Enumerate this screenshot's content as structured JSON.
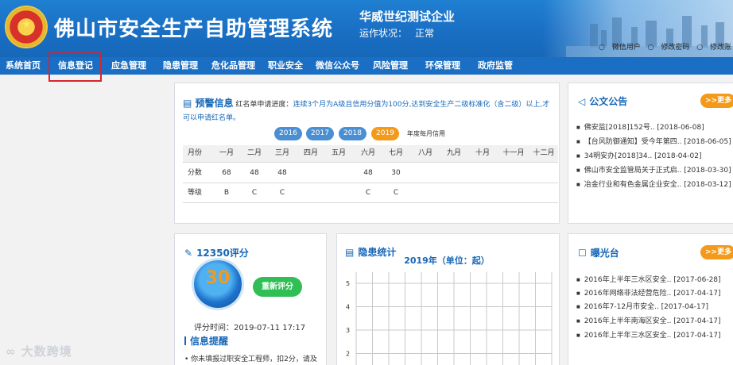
{
  "header": {
    "title": "佛山市安全生产自助管理系统",
    "company": "华威世纪测试企业",
    "status_label": "运作状况：",
    "status_value": "正常",
    "user_links": [
      "微信用户",
      "修改密码",
      "修改账"
    ]
  },
  "nav": {
    "items": [
      "系统首页",
      "信息登记",
      "应急管理",
      "隐患管理",
      "危化品管理",
      "职业安全",
      "微信公众号",
      "风险管理",
      "环保管理",
      "政府监管"
    ],
    "highlighted": "信息登记"
  },
  "warning": {
    "title": "预警信息",
    "redlist_label": "红名单申请进度：",
    "requirement": "连续3个月为A级且信用分值为100分,达到安全生产二级标准化（含二级）以上,才",
    "requirement2": "可以申请红名单。",
    "years": [
      "2016",
      "2017",
      "2018",
      "2019"
    ],
    "active_year": "2019",
    "year_note": "年度每月信用",
    "table": {
      "headers": [
        "月份",
        "一月",
        "二月",
        "三月",
        "四月",
        "五月",
        "六月",
        "七月",
        "八月",
        "九月",
        "十月",
        "十一月",
        "十二月"
      ],
      "rows": [
        [
          "分数",
          "68",
          "48",
          "48",
          "",
          "",
          "48",
          "30",
          "",
          "",
          "",
          "",
          ""
        ],
        [
          "等级",
          "B",
          "C",
          "C",
          "",
          "",
          "C",
          "C",
          "",
          "",
          "",
          "",
          ""
        ]
      ]
    }
  },
  "notices": {
    "title": "公文公告",
    "more": ">>更多",
    "items": [
      "佛安监[2018]152号.. [2018-06-08]",
      "【台风防御通知】受今年第四.. [2018-06-05]",
      "34明安办[2018]34.. [2018-04-02]",
      "佛山市安全监管局关于正式启.. [2018-03-30]",
      "冶金行业和有色金属企业安全.. [2018-03-12]"
    ]
  },
  "score": {
    "title": "12350评分",
    "value": "30",
    "rescore": "重新评分",
    "time": "评分时间：2019-07-11 17:17",
    "remind_title": "信息提醒",
    "remind_text": "• 你未填报过职安全工程师，扣2分，请及"
  },
  "hazard": {
    "title": "隐患统计",
    "chart_title": "2019年（单位：起）"
  },
  "exposure": {
    "title": "曝光台",
    "more": ">>更多",
    "items": [
      "2016年上半年三水区安全.. [2017-06-28]",
      "2016年网络非法经营危险.. [2017-04-17]",
      "2016年7-12月市安全.. [2017-04-17]",
      "2016年上半年南海区安全.. [2017-04-17]",
      "2016年上半年三水区安全.. [2017-04-17]"
    ]
  },
  "watermark": "大数跨境",
  "chart_data": {
    "type": "bar",
    "title": "2019年（单位：起）",
    "yticks": [
      2,
      3,
      4,
      5
    ],
    "ylim": [
      1,
      5
    ],
    "grid": true,
    "series": []
  },
  "colors": {
    "header_blue": "#1a6fc4",
    "accent_blue": "#1667b8",
    "orange": "#f39a1a",
    "green": "#2fbf55",
    "highlight_red": "#d9232b"
  }
}
